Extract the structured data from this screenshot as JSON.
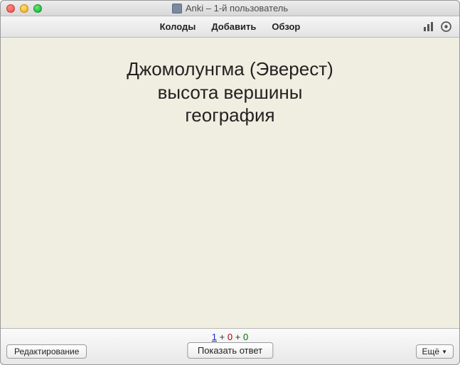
{
  "window": {
    "title": "Anki – 1-й пользователь"
  },
  "toolbar": {
    "decks": "Колоды",
    "add": "Добавить",
    "browse": "Обзор"
  },
  "card": {
    "line1": "Джомолунгма (Эверест)",
    "line2": "высота вершины",
    "line3": "география"
  },
  "counts": {
    "new": "1",
    "learn": "0",
    "review": "0",
    "sep": "+"
  },
  "buttons": {
    "edit": "Редактирование",
    "show_answer": "Показать ответ",
    "more": "Ещё"
  }
}
